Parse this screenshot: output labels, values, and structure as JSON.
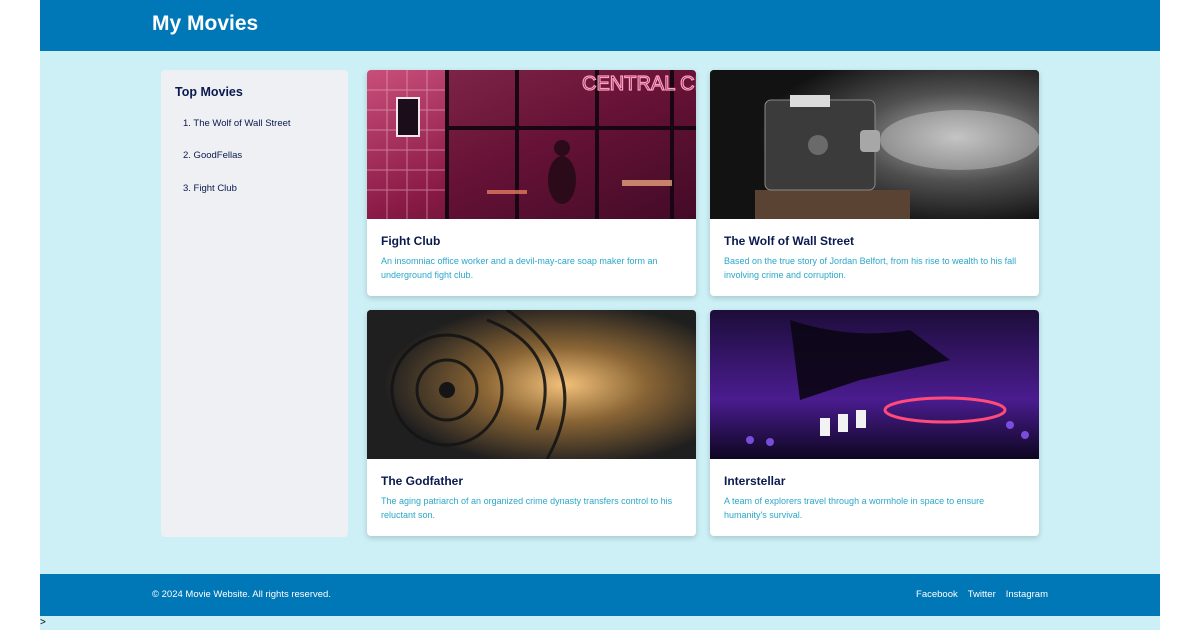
{
  "header": {
    "title": "My Movies"
  },
  "sidebar": {
    "heading": "Top Movies",
    "items": [
      {
        "label": "1. The Wolf of Wall Street"
      },
      {
        "label": "2. GoodFellas"
      },
      {
        "label": "3. Fight Club"
      }
    ]
  },
  "cards": [
    {
      "title": "Fight Club",
      "description": "An insomniac office worker and a devil-may-care soap maker form an underground fight club.",
      "image_text": "CENTRAL CINEMA"
    },
    {
      "title": "The Wolf of Wall Street",
      "description": "Based on the true story of Jordan Belfort, from his rise to wealth to his fall involving crime and corruption."
    },
    {
      "title": "The Godfather",
      "description": "The aging patriarch of an organized crime dynasty transfers control to his reluctant son."
    },
    {
      "title": "Interstellar",
      "description": "A team of explorers travel through a wormhole in space to ensure humanity's survival."
    }
  ],
  "footer": {
    "copyright": "© 2024 Movie Website. All rights reserved.",
    "links": [
      {
        "label": "Facebook"
      },
      {
        "label": "Twitter"
      },
      {
        "label": "Instagram"
      }
    ]
  },
  "stray_text": ">",
  "colors": {
    "header_bg": "#0077b6",
    "page_bg": "#ccf0f6",
    "sidebar_bg": "#eef0f3",
    "title_text": "#0a1a4f",
    "description_text": "#2aa7c9"
  }
}
